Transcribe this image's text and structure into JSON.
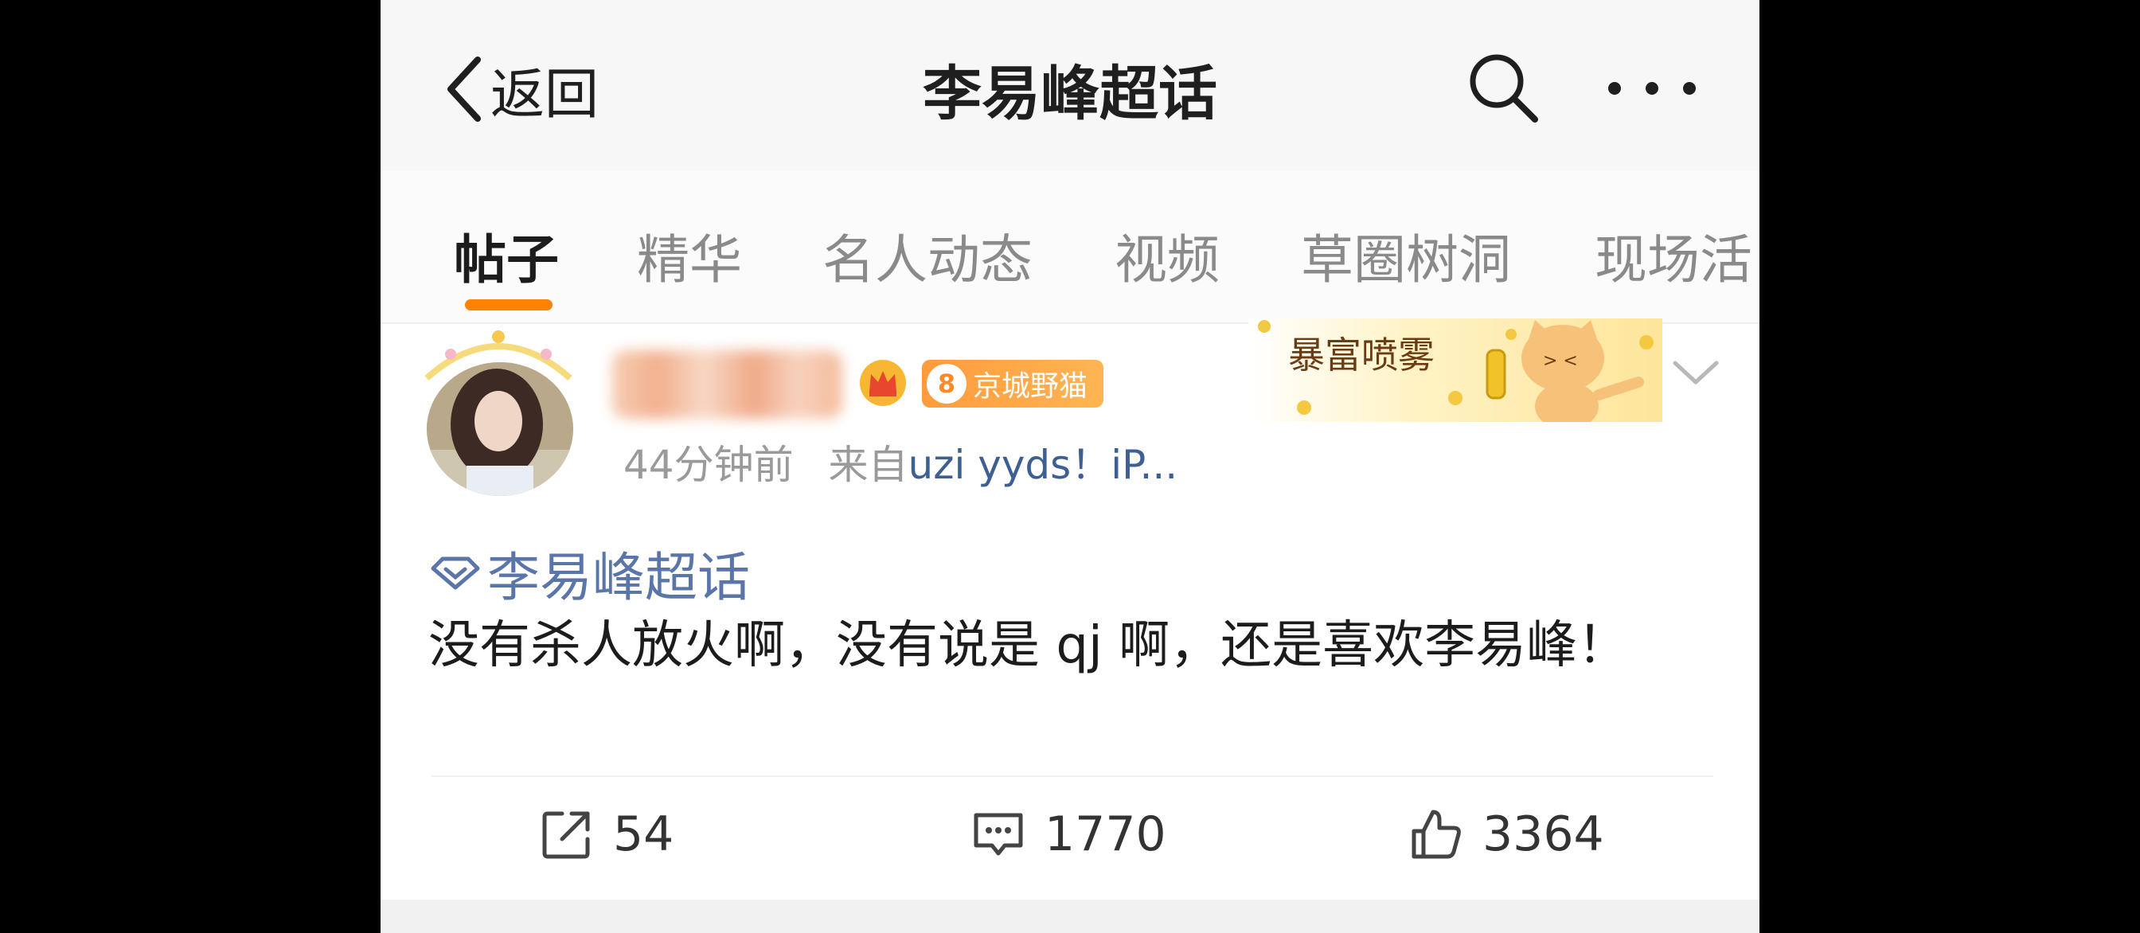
{
  "nav": {
    "back_label": "返回",
    "title": "李易峰超话"
  },
  "tabs": [
    {
      "label": "帖子",
      "active": true
    },
    {
      "label": "精华",
      "active": false
    },
    {
      "label": "名人动态",
      "active": false
    },
    {
      "label": "视频",
      "active": false
    },
    {
      "label": "草圈树洞",
      "active": false
    },
    {
      "label": "现场活",
      "active": false
    }
  ],
  "post": {
    "fan_badge": {
      "level": "8",
      "name": "京城野猫"
    },
    "time": "44分钟前",
    "source_prefix": "来自",
    "source": "uzi yyds！iP...",
    "card_decoration_text": "暴富喷雾",
    "topic": "李易峰超话",
    "text": "没有杀人放火啊，没有说是 qj 啊，还是喜欢李易峰！",
    "actions": {
      "repost_count": "54",
      "comment_count": "1770",
      "like_count": "3364"
    }
  },
  "colors": {
    "accent": "#ff8200",
    "link": "#5a76a8",
    "text": "#1c1c1c",
    "muted": "#9a9a9a"
  },
  "icons": [
    "back-arrow-icon",
    "search-icon",
    "more-icon",
    "crown-icon",
    "chevron-down-icon",
    "topic-diamond-icon",
    "repost-icon",
    "comment-icon",
    "like-icon"
  ]
}
